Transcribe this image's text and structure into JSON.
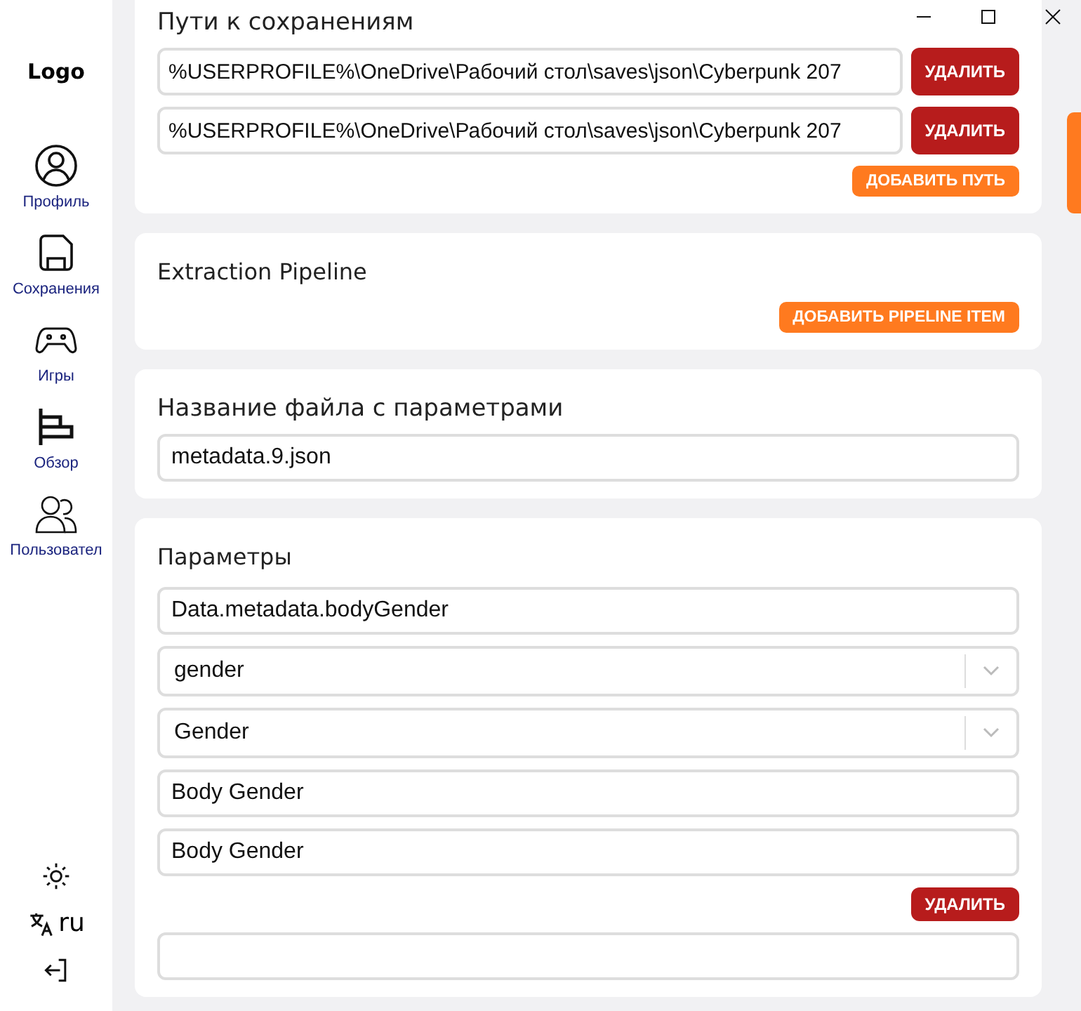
{
  "sidebar": {
    "logo": "Logo",
    "items": [
      {
        "kind": "profile",
        "label": "Профиль"
      },
      {
        "kind": "save",
        "label": "Сохранения"
      },
      {
        "kind": "gamepad",
        "label": "Игры"
      },
      {
        "kind": "overview",
        "label": "Обзор"
      },
      {
        "kind": "users",
        "label": "Пользовател"
      }
    ],
    "language": "ru"
  },
  "save_paths": {
    "title": "Пути к сохранениям",
    "paths": [
      {
        "value": "%USERPROFILE%\\OneDrive\\Рабочий стол\\saves\\json\\Cyberpunk 207",
        "delete": "УДАЛИТЬ"
      },
      {
        "value": "%USERPROFILE%\\OneDrive\\Рабочий стол\\saves\\json\\Cyberpunk 207",
        "delete": "УДАЛИТЬ"
      }
    ],
    "add": "ДОБАВИТЬ ПУТЬ"
  },
  "pipeline": {
    "title": "Extraction Pipeline",
    "add": "ДОБАВИТЬ PIPELINE ITEM"
  },
  "params_file": {
    "title": "Название файла с параметрами",
    "value": "metadata.9.json"
  },
  "params": {
    "title": "Параметры",
    "fields": [
      {
        "kind": "text",
        "value": "Data.metadata.bodyGender"
      },
      {
        "kind": "select",
        "value": "gender"
      },
      {
        "kind": "select",
        "value": "Gender"
      },
      {
        "kind": "text",
        "value": "Body Gender"
      },
      {
        "kind": "text",
        "value": "Body Gender"
      }
    ],
    "delete": "УДАЛИТЬ"
  }
}
